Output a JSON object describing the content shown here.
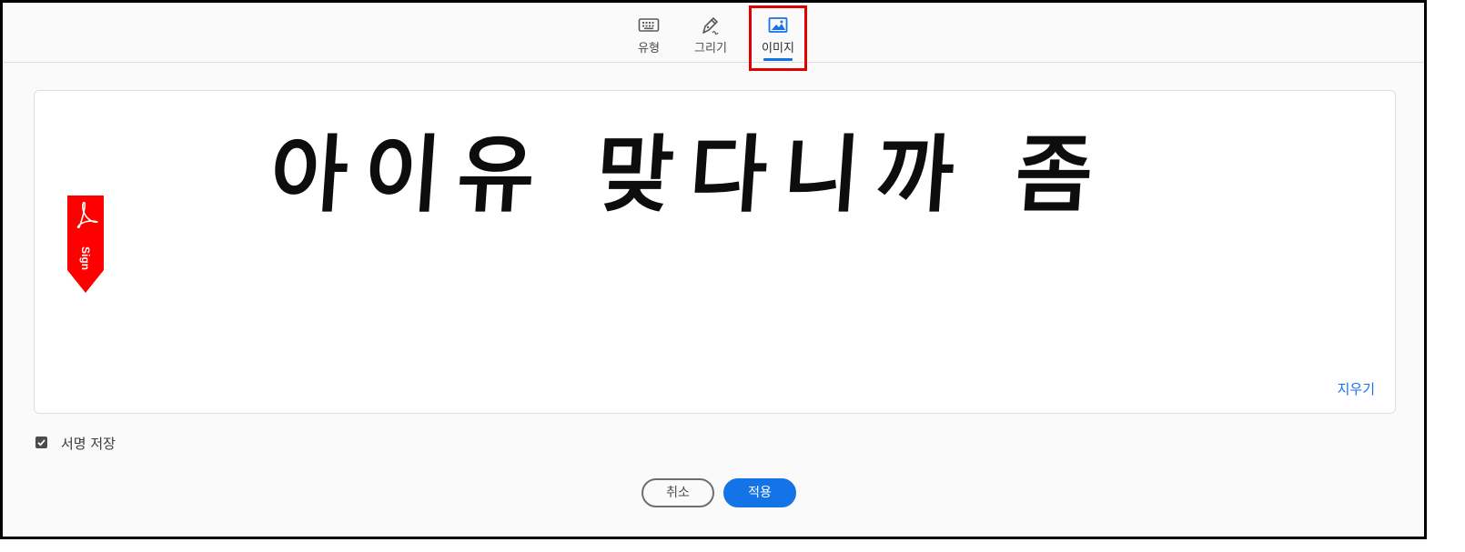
{
  "tabs": [
    {
      "label": "유형",
      "icon": "keyboard-icon"
    },
    {
      "label": "그리기",
      "icon": "pen-icon"
    },
    {
      "label": "이미지",
      "icon": "image-icon"
    }
  ],
  "active_tab": "이미지",
  "signature": {
    "text": "아이유 맞다니까 좀",
    "badge": "Sign",
    "clear_label": "지우기"
  },
  "save_signature": {
    "label": "서명 저장",
    "checked": true
  },
  "buttons": {
    "cancel": "취소",
    "apply": "적용"
  },
  "colors": {
    "accent": "#1473e6",
    "badge": "#ff0000",
    "highlight": "#e00000"
  }
}
